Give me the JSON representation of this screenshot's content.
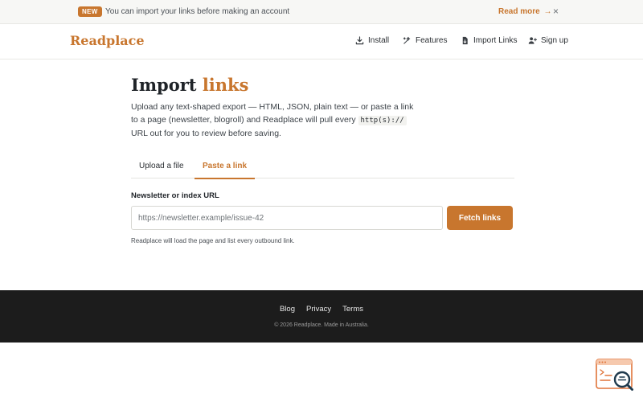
{
  "announcement": {
    "badge": "NEW",
    "text": "You can import your links before making an account",
    "link_label": "Read more",
    "link_arrow": "→",
    "close_glyph": "×"
  },
  "header": {
    "logo": "Readplace",
    "nav": [
      {
        "label": "Install",
        "icon": "download-icon"
      },
      {
        "label": "Features",
        "icon": "sparkle-icon"
      },
      {
        "label": "Import Links",
        "icon": "file-import-icon"
      },
      {
        "label": "Sign up",
        "icon": "user-plus-icon"
      }
    ]
  },
  "main": {
    "title_part1": "Import",
    "title_part2": "links",
    "lede_before": "Upload any text-shaped export — HTML, JSON, plain text — or paste a link to a page (newsletter, blogroll) and Readplace will pull every",
    "lede_code": "http(s)://",
    "lede_after": "URL out for you to review before saving.",
    "tabs": [
      {
        "label": "Upload a file",
        "active": false
      },
      {
        "label": "Paste a link",
        "active": true
      }
    ],
    "field_label": "Newsletter or index URL",
    "input_placeholder": "https://newsletter.example/issue-42",
    "input_value": "",
    "button_label": "Fetch links",
    "helper_text": "Readplace will load the page and list every outbound link."
  },
  "footer": {
    "links": [
      "Blog",
      "Privacy",
      "Terms"
    ],
    "copyright": "© 2026 Readplace. Made in Australia."
  },
  "colors": {
    "accent": "#c8762e",
    "footer_bg": "#1c1c1c",
    "text": "#1f2328"
  },
  "widget": {
    "icon": "search-feedback-icon"
  }
}
